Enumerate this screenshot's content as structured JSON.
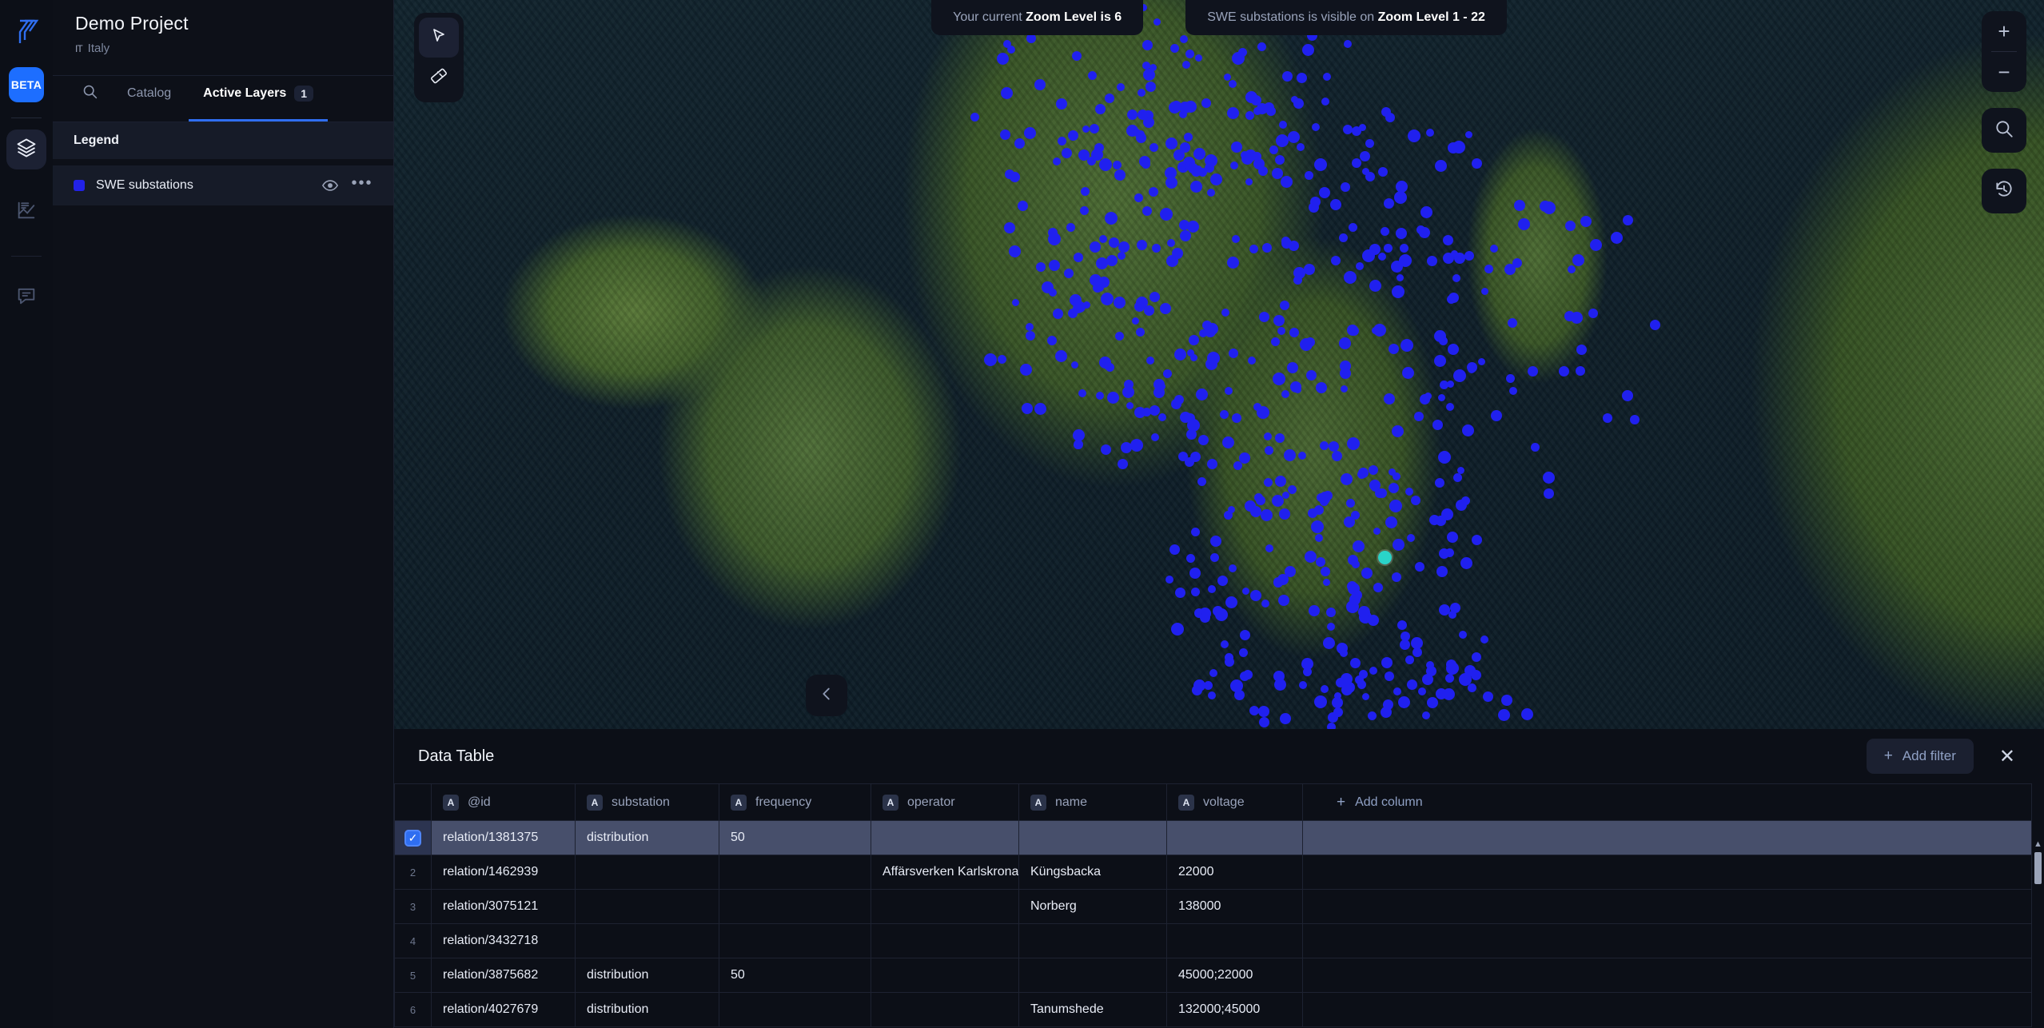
{
  "rail": {
    "logo_icon": "felt-logo-icon",
    "beta_label": "BETA",
    "items": [
      {
        "name": "layers-icon",
        "active": true
      },
      {
        "name": "chart-icon",
        "active": false
      },
      {
        "name": "comment-icon",
        "active": false
      }
    ]
  },
  "panel": {
    "project_title": "Demo Project",
    "project_flag": "IT",
    "project_country": "Italy",
    "tabs": [
      {
        "label": "",
        "icon": "search-icon",
        "active": false
      },
      {
        "label": "Catalog",
        "active": false
      },
      {
        "label": "Active Layers",
        "badge": "1",
        "active": true
      }
    ],
    "legend_title": "Legend",
    "layers": [
      {
        "name": "SWE substations",
        "color": "#2222e8",
        "visibility_icon": "eye-icon",
        "more_icon": "more-options-icon"
      }
    ]
  },
  "map": {
    "zoom_pills": [
      {
        "prefix": "Your current ",
        "strong": "Zoom Level is 6"
      },
      {
        "prefix": "SWE substations is visible on ",
        "strong": "Zoom Level 1 - 22"
      }
    ],
    "tools": [
      {
        "name": "cursor-select-tool",
        "active": true
      },
      {
        "name": "measure-ruler-tool",
        "active": false
      }
    ],
    "controls": {
      "zoom_in": "+",
      "zoom_out": "−",
      "search_icon": "search-icon",
      "history_icon": "history-icon",
      "collapse_icon": "chevron-left-icon"
    },
    "marker_color": "#2020ef",
    "selected_marker_color": "#2ad4c8"
  },
  "data_table": {
    "title": "Data Table",
    "add_filter_label": "Add filter",
    "add_column_label": "Add column",
    "close_icon": "close-icon",
    "columns": [
      {
        "label": "@id",
        "type": "A"
      },
      {
        "label": "substation",
        "type": "A"
      },
      {
        "label": "frequency",
        "type": "A"
      },
      {
        "label": "operator",
        "type": "A"
      },
      {
        "label": "name",
        "type": "A"
      },
      {
        "label": "voltage",
        "type": "A"
      }
    ],
    "rows": [
      {
        "index": "1",
        "selected": true,
        "@id": "relation/1381375",
        "substation": "distribution",
        "frequency": "50",
        "operator": "",
        "name": "",
        "voltage": ""
      },
      {
        "index": "2",
        "selected": false,
        "@id": "relation/1462939",
        "substation": "",
        "frequency": "",
        "operator": "Affärsverken Karlskrona",
        "name": "Küngsbacka",
        "voltage": "22000"
      },
      {
        "index": "3",
        "selected": false,
        "@id": "relation/3075121",
        "substation": "",
        "frequency": "",
        "operator": "",
        "name": "Norberg",
        "voltage": "138000"
      },
      {
        "index": "4",
        "selected": false,
        "@id": "relation/3432718",
        "substation": "",
        "frequency": "",
        "operator": "",
        "name": "",
        "voltage": ""
      },
      {
        "index": "5",
        "selected": false,
        "@id": "relation/3875682",
        "substation": "distribution",
        "frequency": "50",
        "operator": "",
        "name": "",
        "voltage": "45000;22000"
      },
      {
        "index": "6",
        "selected": false,
        "@id": "relation/4027679",
        "substation": "distribution",
        "frequency": "",
        "operator": "",
        "name": "Tanumshede",
        "voltage": "132000;45000"
      }
    ]
  }
}
